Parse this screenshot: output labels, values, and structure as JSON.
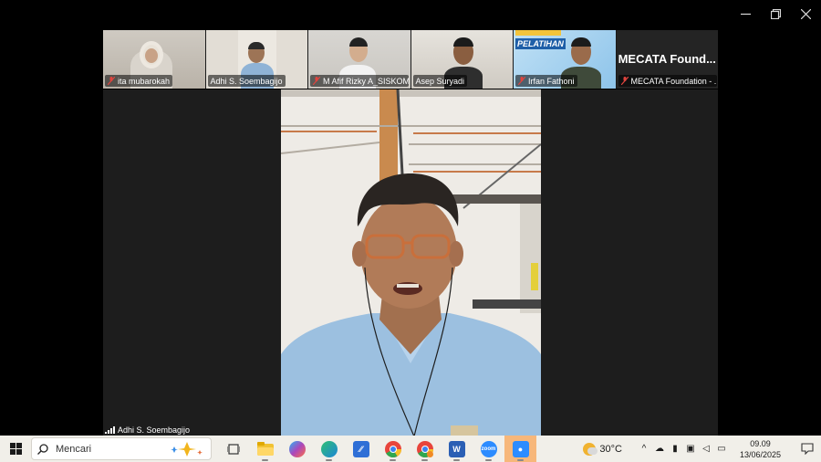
{
  "window": {
    "controls": [
      "minimize-icon",
      "restore-icon",
      "close-icon"
    ]
  },
  "gallery": [
    {
      "name": "ita mubarokah",
      "muted": true,
      "active": false
    },
    {
      "name": "Adhi S. Soembagijo",
      "muted": false,
      "active": true
    },
    {
      "name": "M Afif Rizky A_SISKOM",
      "muted": true,
      "active": false
    },
    {
      "name": "Asep Suryadi",
      "muted": false,
      "active": false
    },
    {
      "name": "Irfan Fathoni",
      "muted": true,
      "active": false,
      "background_text": "PELATIHAN"
    },
    {
      "name": "MECATA Foundation - ...",
      "muted": true,
      "active": false,
      "big_name": "MECATA  Found..."
    }
  ],
  "stage": {
    "speaker_name": "Adhi S. Soembagijo"
  },
  "taskbar": {
    "search_placeholder": "Mencari",
    "apps": [
      "task-view-icon",
      "file-explorer-icon",
      "copilot-icon",
      "edge-icon",
      "vs-icon",
      "chrome-icon",
      "chrome-profile-icon",
      "word-icon",
      "zoom-icon",
      "zoom-meeting-icon"
    ],
    "temperature": "30°C",
    "time": "09.09",
    "date": "13/06/2025"
  },
  "colors": {
    "active_speaker": "#2ec27e",
    "mic_off": "#e0443e",
    "taskbar_bg": "#f1efe9",
    "focused_app": "#f7b77a"
  }
}
